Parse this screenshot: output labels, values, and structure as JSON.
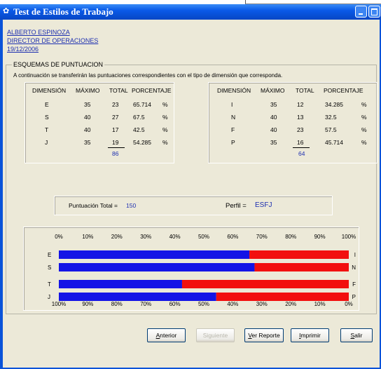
{
  "window": {
    "title": "Test de Estilos de Trabajo"
  },
  "header": {
    "name": "ALBERTO ESPINOZA",
    "position": "DIRECTOR DE OPERACIONES",
    "date": "19/12/2006"
  },
  "group": {
    "title": "ESQUEMAS DE PUNTUACION",
    "intro": "A continuación se transferirán las puntuaciones correspondientes con el tipo de dimensión que corresponda."
  },
  "columns": [
    "DIMENSIÓN",
    "MÁXIMO",
    "TOTAL",
    "PORCENTAJE"
  ],
  "left_table": {
    "rows": [
      {
        "dim": "E",
        "max": "35",
        "total": "23",
        "pct": "65.714",
        "sym": "%"
      },
      {
        "dim": "S",
        "max": "40",
        "total": "27",
        "pct": "67.5",
        "sym": "%"
      },
      {
        "dim": "T",
        "max": "40",
        "total": "17",
        "pct": "42.5",
        "sym": "%"
      },
      {
        "dim": "J",
        "max": "35",
        "total": "19",
        "pct": "54.285",
        "sym": "%"
      }
    ],
    "sum": "86"
  },
  "right_table": {
    "rows": [
      {
        "dim": "I",
        "max": "35",
        "total": "12",
        "pct": "34.285",
        "sym": "%"
      },
      {
        "dim": "N",
        "max": "40",
        "total": "13",
        "pct": "32.5",
        "sym": "%"
      },
      {
        "dim": "F",
        "max": "40",
        "total": "23",
        "pct": "57.5",
        "sym": "%"
      },
      {
        "dim": "P",
        "max": "35",
        "total": "16",
        "pct": "45.714",
        "sym": "%"
      }
    ],
    "sum": "64"
  },
  "summary": {
    "total_label": "Puntuación Total =",
    "total_value": "150",
    "profile_label": "Perfil =",
    "profile_value": "ESFJ"
  },
  "chart_data": {
    "type": "bar",
    "top_ticks": [
      "0%",
      "10%",
      "20%",
      "30%",
      "40%",
      "50%",
      "60%",
      "70%",
      "80%",
      "90%",
      "100%"
    ],
    "bottom_ticks": [
      "100%",
      "90%",
      "80%",
      "70%",
      "60%",
      "50%",
      "40%",
      "30%",
      "20%",
      "10%",
      "0%"
    ],
    "bars": [
      {
        "left": "E",
        "right": "I",
        "value": 65.714
      },
      {
        "left": "S",
        "right": "N",
        "value": 67.5
      },
      {
        "left": "T",
        "right": "F",
        "value": 42.5
      },
      {
        "left": "J",
        "right": "P",
        "value": 54.285
      }
    ],
    "colors": {
      "left": "#1414e6",
      "right": "#f20f0f"
    }
  },
  "buttons": {
    "prev": {
      "u": "A",
      "rest": "nterior"
    },
    "next": "Siguiente",
    "report": {
      "u": "V",
      "rest": "er Reporte"
    },
    "print": {
      "u": "I",
      "rest": "mprimir"
    },
    "exit": {
      "u": "S",
      "rest": "alir"
    }
  }
}
